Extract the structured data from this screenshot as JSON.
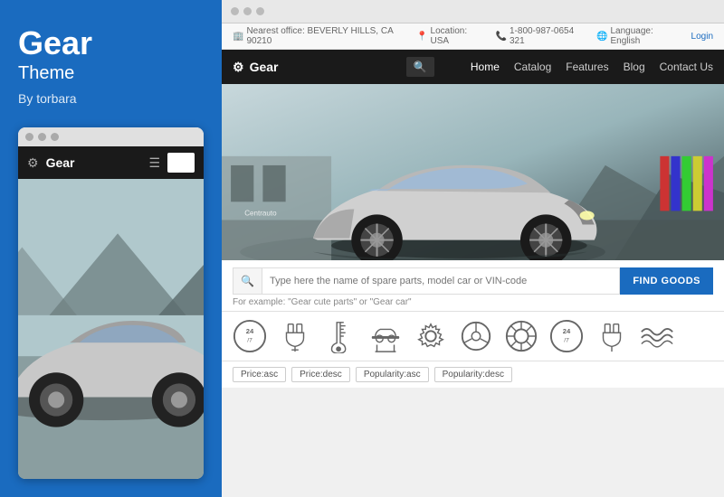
{
  "left": {
    "title": "Gear",
    "subtitle": "Theme",
    "author": "By torbara",
    "mobile": {
      "brand": "Gear",
      "dots": [
        "dot1",
        "dot2",
        "dot3"
      ]
    }
  },
  "browser": {
    "dots": [
      "dot1",
      "dot2",
      "dot3"
    ]
  },
  "infobar": {
    "office": "Nearest office: BEVERLY HILLS, CA 90210",
    "location": "Location: USA",
    "phone": "1-800-987-0654 321",
    "language": "Language: English",
    "login": "Login"
  },
  "nav": {
    "brand": "Gear",
    "links": [
      "Home",
      "Catalog",
      "Features",
      "Blog",
      "Contact Us"
    ]
  },
  "search": {
    "placeholder": "Type here the name of spare parts, model car or VIN-code",
    "hint": "For example: \"Gear cute parts\" or \"Gear car\"",
    "button": "FIND GOODS"
  },
  "icons": [
    {
      "name": "24-7-icon",
      "unicode": "⏰"
    },
    {
      "name": "plug-car-icon",
      "unicode": "🔌"
    },
    {
      "name": "temperature-icon",
      "unicode": "🌡"
    },
    {
      "name": "car-service-icon",
      "unicode": "🚗"
    },
    {
      "name": "settings-car-icon",
      "unicode": "⚙"
    },
    {
      "name": "steering-icon",
      "unicode": "🎯"
    },
    {
      "name": "wheel-icon",
      "unicode": "⭕"
    },
    {
      "name": "clock-icon",
      "unicode": "⏰"
    },
    {
      "name": "battery-icon",
      "unicode": "🔋"
    },
    {
      "name": "waves-icon",
      "unicode": "〰"
    }
  ],
  "tags": [
    {
      "label": "Price:asc"
    },
    {
      "label": "Price:desc"
    },
    {
      "label": "Popularity:asc"
    },
    {
      "label": "Popularity:desc"
    }
  ]
}
